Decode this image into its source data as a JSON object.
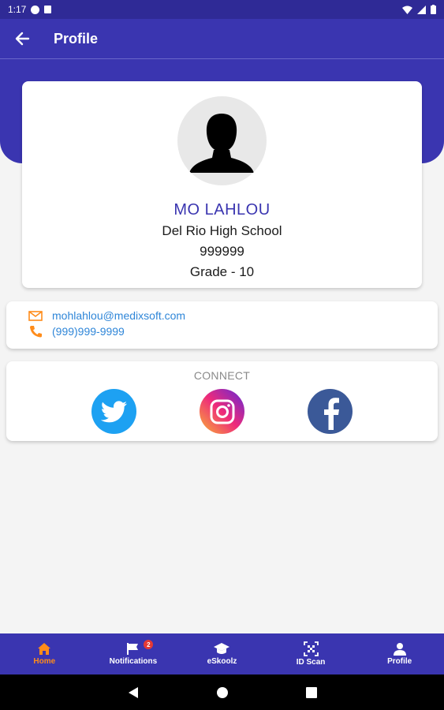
{
  "status_bar": {
    "time": "1:17"
  },
  "app_bar": {
    "title": "Profile"
  },
  "profile": {
    "name": "MO LAHLOU",
    "school": "Del Rio High School",
    "id_number": "999999",
    "grade": "Grade - 10"
  },
  "contact": {
    "email": "mohlahlou@medixsoft.com",
    "phone": "(999)999-9999"
  },
  "connect": {
    "label": "CONNECT",
    "networks": [
      "twitter",
      "instagram",
      "facebook"
    ]
  },
  "bottom_nav": {
    "items": [
      {
        "label": "Home",
        "icon": "home-icon",
        "active": true
      },
      {
        "label": "Notifications",
        "icon": "flag-icon",
        "badge": "2"
      },
      {
        "label": "eSkoolz",
        "icon": "graduation-cap-icon"
      },
      {
        "label": "ID Scan",
        "icon": "qr-scan-icon"
      },
      {
        "label": "Profile",
        "icon": "person-icon"
      }
    ]
  },
  "colors": {
    "primary": "#3a35b0",
    "accent_orange": "#ff8c1a",
    "link_blue": "#2f86d8",
    "twitter": "#1da1f2",
    "facebook": "#3b5998",
    "badge_red": "#e53935"
  }
}
